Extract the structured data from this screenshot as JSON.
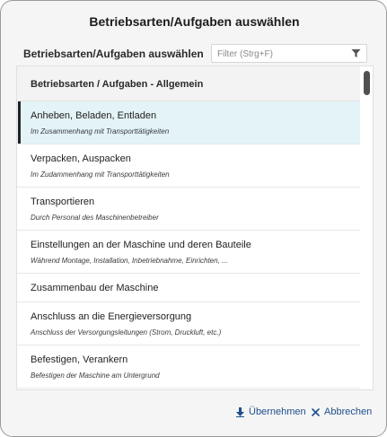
{
  "dialog": {
    "title": "Betriebsarten/Aufgaben auswählen",
    "sub_header": "Betriebsarten/Aufgaben auswählen"
  },
  "filter": {
    "placeholder": "Filter (Strg+F)",
    "value": "",
    "icon": "filter-icon"
  },
  "list": {
    "group_header": "Betriebsarten / Aufgaben - Allgemein",
    "items": [
      {
        "title": "Anheben, Beladen, Entladen",
        "subtitle": "Im Zusammenhang mit Transporttätigkeiten"
      },
      {
        "title": "Verpacken, Auspacken",
        "subtitle": "Im Zudammenhang mit Transporttätigkeiten"
      },
      {
        "title": "Transportieren",
        "subtitle": "Durch Personal des Maschinenbetreiber"
      },
      {
        "title": "Einstellungen an der Maschine und deren Bauteile",
        "subtitle": "Während Montage, Installation, Inbetriebnahme, Einrichten, ..."
      },
      {
        "title": "Zusammenbau der Maschine"
      },
      {
        "title": "Anschluss an die Energieversorgung",
        "subtitle": "Anschluss der Versorgungsleitungen (Strom, Druckluft, etc.)"
      },
      {
        "title": "Befestigen, Verankern",
        "subtitle": "Befestigen der Maschine am Untergrund"
      }
    ]
  },
  "footer": {
    "apply_label": "Übernehmen",
    "apply_icon": "arrow-down-icon",
    "cancel_label": "Abbrechen",
    "cancel_icon": "close-icon",
    "accent_color": "#1f4f8c"
  }
}
